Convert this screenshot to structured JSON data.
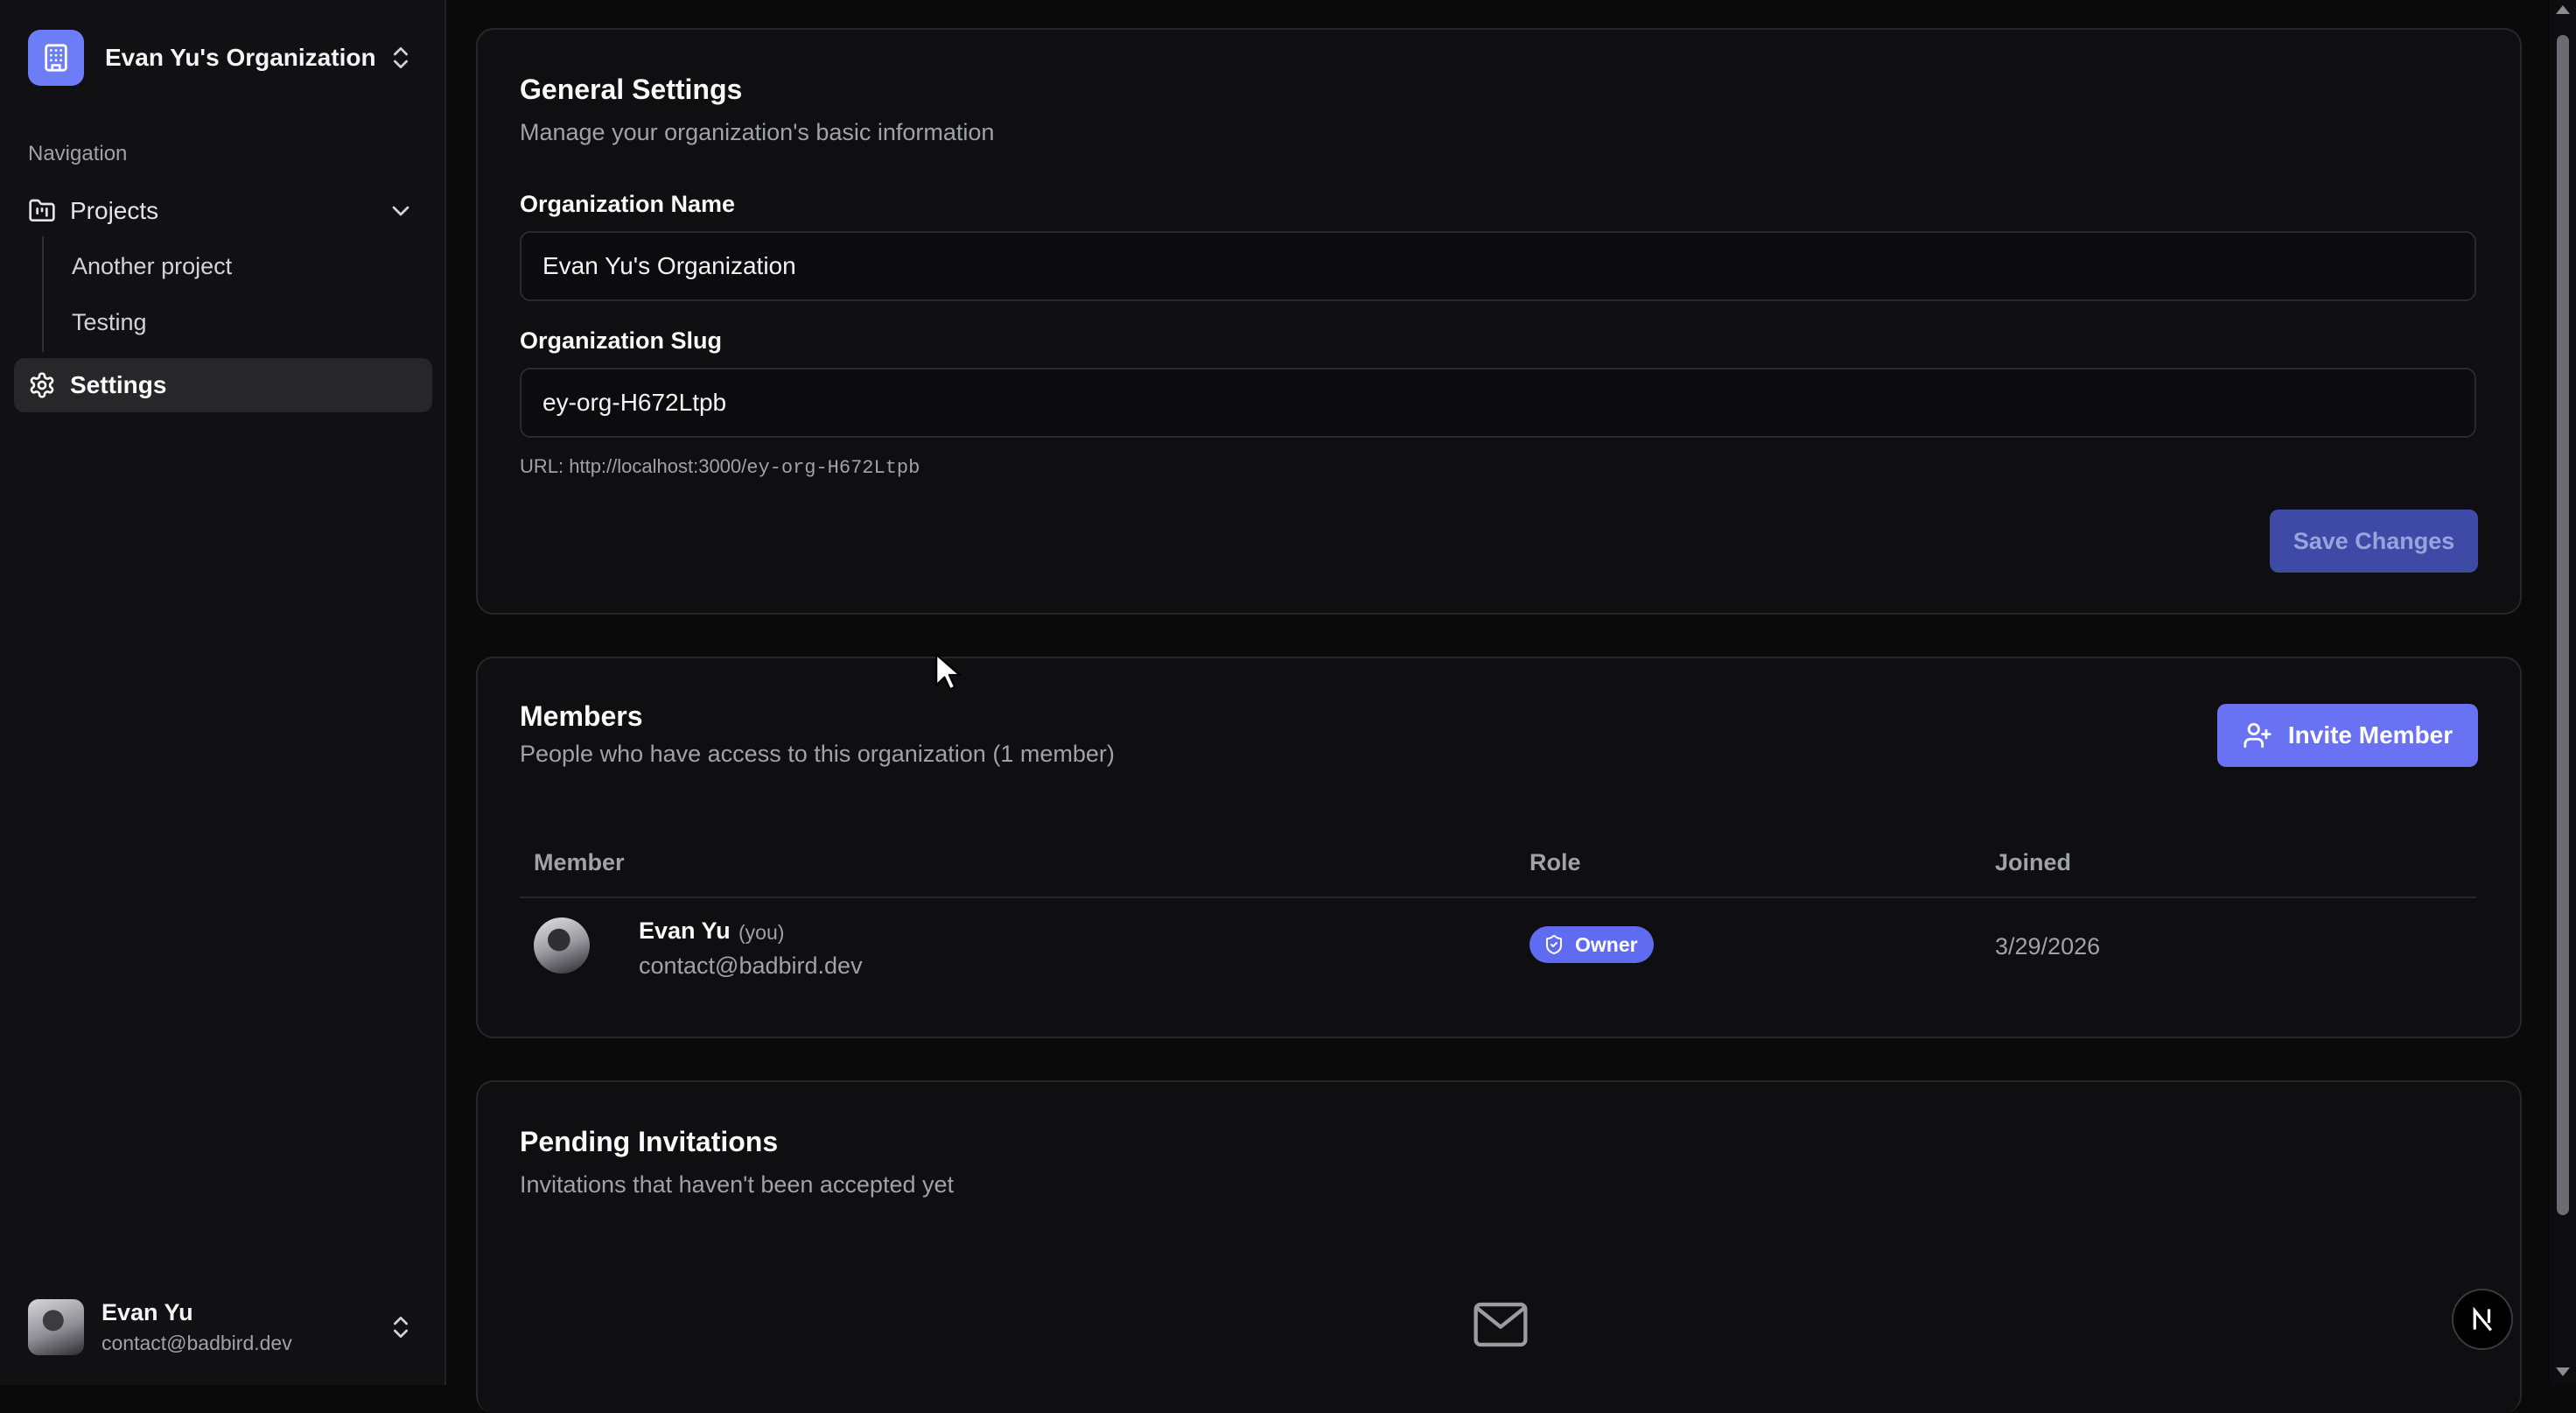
{
  "sidebar": {
    "org_name": "Evan Yu's Organization",
    "nav_heading": "Navigation",
    "projects_label": "Projects",
    "projects": [
      "Another project",
      "Testing"
    ],
    "settings_label": "Settings",
    "user": {
      "name": "Evan Yu",
      "email": "contact@badbird.dev"
    }
  },
  "general": {
    "title": "General Settings",
    "description": "Manage your organization's basic information",
    "org_name_label": "Organization Name",
    "org_name_value": "Evan Yu's Organization",
    "org_slug_label": "Organization Slug",
    "org_slug_value": "ey-org-H672Ltpb",
    "url_prefix": "URL: http://localhost:3000/",
    "url_slug": "ey-org-H672Ltpb",
    "save_label": "Save Changes"
  },
  "members": {
    "title": "Members",
    "description": "People who have access to this organization (1 member)",
    "invite_label": "Invite Member",
    "columns": [
      "Member",
      "Role",
      "Joined"
    ],
    "rows": [
      {
        "name": "Evan Yu",
        "tag": "(you)",
        "email": "contact@badbird.dev",
        "role": "Owner",
        "joined": "3/29/2026"
      }
    ]
  },
  "pending": {
    "title": "Pending Invitations",
    "description": "Invitations that haven't been accepted yet"
  },
  "colors": {
    "accent": "#6872f3",
    "accent_muted": "#3f4aa6",
    "background": "#0a0a0b",
    "sidebar": "#111113"
  },
  "icons": [
    "building-icon",
    "chevrons-up-down-icon",
    "folder-icon",
    "chevron-down-icon",
    "gear-icon",
    "user-plus-icon",
    "shield-icon",
    "mail-icon",
    "next-logo-icon"
  ]
}
